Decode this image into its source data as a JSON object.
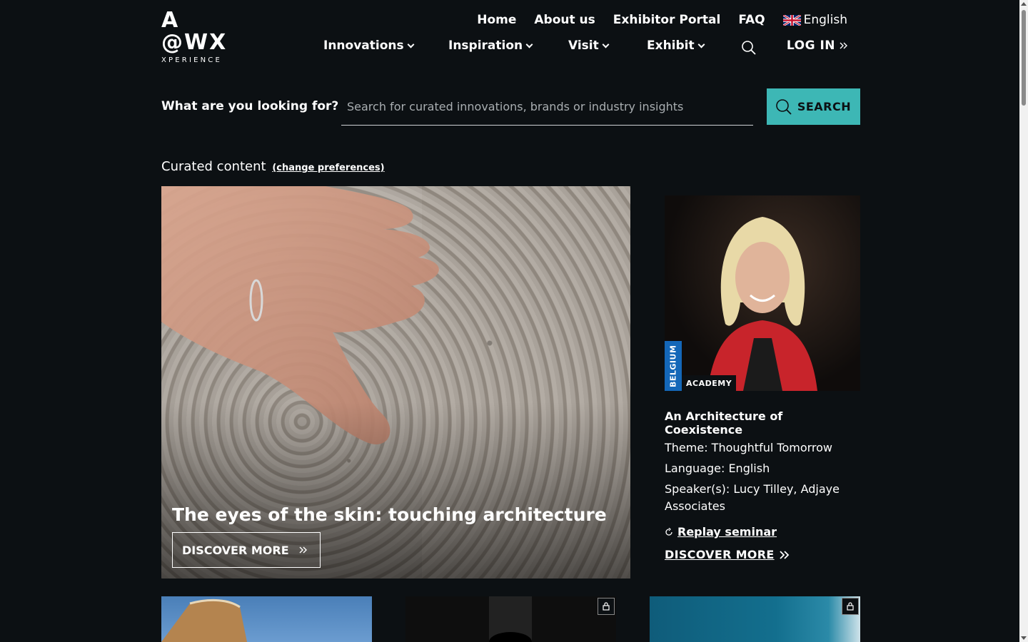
{
  "logo": {
    "line1": "A",
    "line2": "@WX",
    "line3": "XPERIENCE"
  },
  "top_nav": {
    "items": [
      "Home",
      "About us",
      "Exhibitor Portal",
      "FAQ"
    ],
    "language": "English"
  },
  "main_nav": {
    "items": [
      "Innovations",
      "Inspiration",
      "Visit",
      "Exhibit"
    ],
    "login": "LOG IN"
  },
  "search": {
    "label": "What are you looking for?",
    "placeholder": "Search for curated innovations, brands or industry insights",
    "button": "SEARCH"
  },
  "curated": {
    "label": "Curated content",
    "change_link": "(change preferences)"
  },
  "hero": {
    "title": "The eyes of the skin: touching architecture",
    "button": "DISCOVER MORE"
  },
  "card": {
    "country": "BELGIUM",
    "type": "ACADEMY",
    "title": "An Architecture of Coexistence",
    "theme": "Theme: Thoughtful Tomorrow",
    "language": "Language: English",
    "speakers": "Speaker(s): Lucy Tilley, Adjaye Associates",
    "replay": "Replay seminar",
    "discover": "DISCOVER MORE"
  },
  "colors": {
    "background": "#0c1013",
    "accent": "#3db7b5",
    "country_badge": "#1467b8"
  },
  "icons": {
    "search": "search-icon",
    "chevron": "chevron-down-icon",
    "double_chevron": "double-chevron-right-icon",
    "lock": "lock-icon",
    "flag": "uk-flag-icon",
    "replay": "replay-icon"
  }
}
